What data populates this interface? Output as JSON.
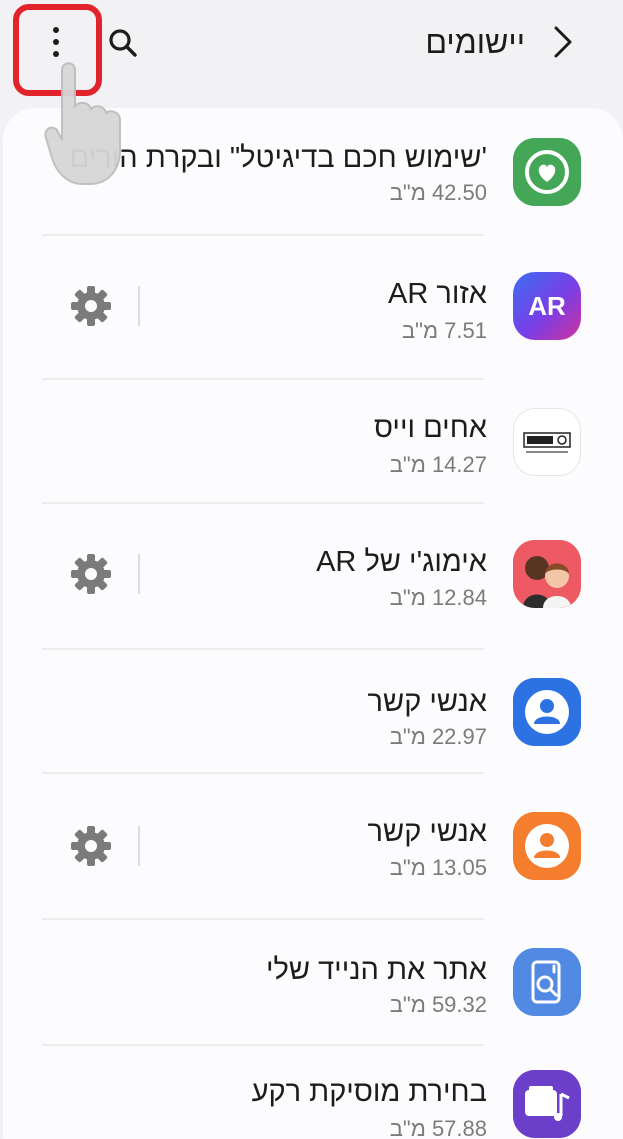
{
  "header": {
    "title": "יישומים",
    "back_icon": "chevron-right-icon",
    "search_icon": "search-icon",
    "more_icon": "more-vertical-icon"
  },
  "apps": [
    {
      "name": "'שימוש חכם בדיגיטל\" ובקרת הורים",
      "size": "42.50 מ\"ב",
      "icon": "digital-wellbeing-icon",
      "has_settings": false
    },
    {
      "name": "אזור AR",
      "size": "7.51 מ\"ב",
      "icon": "ar-zone-icon",
      "icon_text": "AR",
      "has_settings": true
    },
    {
      "name": "אחים וייס",
      "size": "14.27 מ\"ב",
      "icon": "weiss-logo-icon",
      "has_settings": false
    },
    {
      "name": "אימוג'י של AR",
      "size": "12.84 מ\"ב",
      "icon": "ar-emoji-icon",
      "has_settings": true
    },
    {
      "name": "אנשי קשר",
      "size": "22.97 מ\"ב",
      "icon": "contacts-icon",
      "has_settings": false
    },
    {
      "name": "אנשי קשר",
      "size": "13.05 מ\"ב",
      "icon": "contacts-orange-icon",
      "has_settings": true
    },
    {
      "name": "אתר את הנייד שלי",
      "size": "59.32 מ\"ב",
      "icon": "find-my-mobile-icon",
      "has_settings": false
    },
    {
      "name": "בחירת מוסיקת רקע",
      "size": "57.88 מ\"ב",
      "icon": "background-music-icon",
      "has_settings": false
    }
  ],
  "colors": {
    "background": "#f2f2f4",
    "card": "#fcfcfe",
    "highlight": "#e3232c",
    "secondary_text": "#7b7b7b"
  }
}
